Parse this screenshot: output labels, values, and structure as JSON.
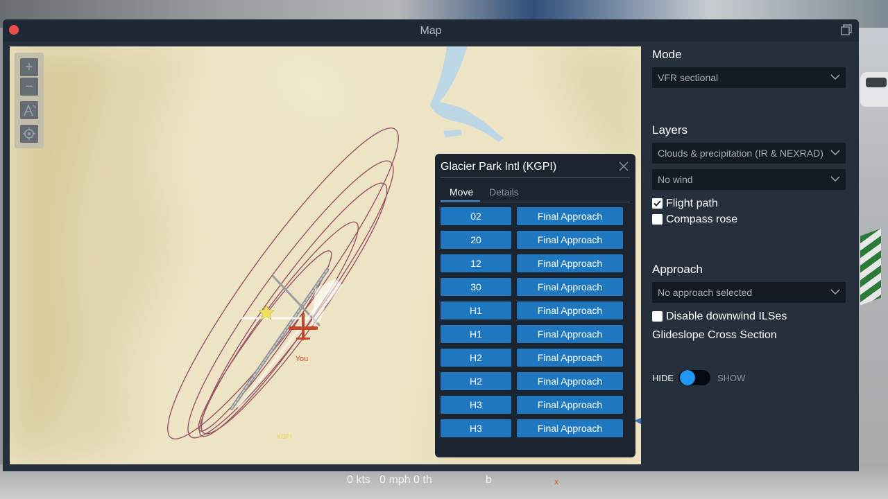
{
  "window": {
    "title": "Map"
  },
  "map": {
    "controls": [
      "zoom-in",
      "zoom-out",
      "north-up",
      "recenter"
    ],
    "aircraft_label": "You",
    "airport_label": "KGPI"
  },
  "popup": {
    "title": "Glacier Park Intl (KGPI)",
    "tabs": [
      "Move",
      "Details"
    ],
    "active_tab": "Move",
    "rows": [
      {
        "runway": "02",
        "action": "Final Approach"
      },
      {
        "runway": "20",
        "action": "Final Approach"
      },
      {
        "runway": "12",
        "action": "Final Approach"
      },
      {
        "runway": "30",
        "action": "Final Approach"
      },
      {
        "runway": "H1",
        "action": "Final Approach"
      },
      {
        "runway": "H1",
        "action": "Final Approach"
      },
      {
        "runway": "H2",
        "action": "Final Approach"
      },
      {
        "runway": "H2",
        "action": "Final Approach"
      },
      {
        "runway": "H3",
        "action": "Final Approach"
      },
      {
        "runway": "H3",
        "action": "Final Approach"
      }
    ]
  },
  "side": {
    "mode_label": "Mode",
    "mode_value": "VFR sectional",
    "layers_label": "Layers",
    "layer_weather": "Clouds & precipitation (IR & NEXRAD)",
    "layer_wind": "No wind",
    "flight_path": {
      "label": "Flight path",
      "checked": true
    },
    "compass_rose": {
      "label": "Compass rose",
      "checked": false
    },
    "approach_label": "Approach",
    "approach_value": "No approach selected",
    "disable_downwind": {
      "label": "Disable downwind ILSes",
      "checked": false
    },
    "glideslope_label": "Glideslope Cross Section",
    "toggle_hide": "HIDE",
    "toggle_show": "SHOW",
    "toggle_state": "hide"
  },
  "hud": {
    "speed": "0 kts   0 mph 0 th",
    "b": "b",
    "x": "x"
  },
  "colors": {
    "accent": "#1f78bf",
    "toggle": "#2196f3",
    "flight_path": "#8a3a55",
    "aircraft": "#c8452d",
    "close": "#ee4c4c"
  }
}
